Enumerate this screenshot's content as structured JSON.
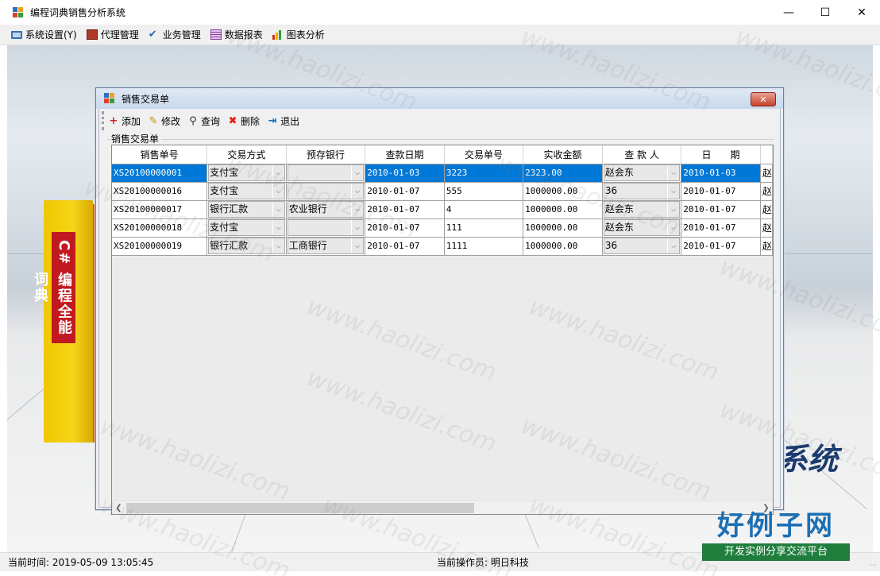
{
  "window": {
    "title": "编程词典销售分析系统"
  },
  "menu": [
    {
      "label": "系统设置(Y)",
      "icon": "monitor-icon"
    },
    {
      "label": "代理管理",
      "icon": "agent-icon"
    },
    {
      "label": "业务管理",
      "icon": "check-icon"
    },
    {
      "label": "数据报表",
      "icon": "report-icon"
    },
    {
      "label": "图表分析",
      "icon": "bar-chart-icon"
    }
  ],
  "child": {
    "title": "销售交易单",
    "toolbar": [
      {
        "label": "添加",
        "icon": "add-icon"
      },
      {
        "label": "修改",
        "icon": "edit-icon"
      },
      {
        "label": "查询",
        "icon": "search-icon"
      },
      {
        "label": "删除",
        "icon": "delete-icon"
      },
      {
        "label": "退出",
        "icon": "exit-icon"
      }
    ],
    "group_label": "销售交易单",
    "columns": [
      "销售单号",
      "交易方式",
      "预存银行",
      "查款日期",
      "交易单号",
      "实收金额",
      "查 款 人",
      "日　　期"
    ],
    "rows": [
      {
        "id": "XS20100000001",
        "method": "支付宝",
        "bank": "",
        "date": "2010-01-03",
        "txn": "3223",
        "amount": "2323.00",
        "checker": "赵会东",
        "day": "2010-01-03",
        "extra": "赵",
        "selected": true
      },
      {
        "id": "XS20100000016",
        "method": "支付宝",
        "bank": "",
        "date": "2010-01-07",
        "txn": "555",
        "amount": "1000000.00",
        "checker": "36",
        "day": "2010-01-07",
        "extra": "赵",
        "selected": false
      },
      {
        "id": "XS20100000017",
        "method": "银行汇款",
        "bank": "农业银行",
        "date": "2010-01-07",
        "txn": "4",
        "amount": "1000000.00",
        "checker": "赵会东",
        "day": "2010-01-07",
        "extra": "赵",
        "selected": false
      },
      {
        "id": "XS20100000018",
        "method": "支付宝",
        "bank": "",
        "date": "2010-01-07",
        "txn": "111",
        "amount": "1000000.00",
        "checker": "赵会东",
        "day": "2010-01-07",
        "extra": "赵",
        "selected": false
      },
      {
        "id": "XS20100000019",
        "method": "银行汇款",
        "bank": "工商银行",
        "date": "2010-01-07",
        "txn": "1111",
        "amount": "1000000.00",
        "checker": "36",
        "day": "2010-01-07",
        "extra": "赵",
        "selected": false
      }
    ]
  },
  "status": {
    "time": "当前时间:  2019-05-09 13:05:45",
    "operator": "当前操作员:  明日科技"
  },
  "background": {
    "logo_text": "系统",
    "book_spine": "C# 编程全能词典"
  },
  "watermark": {
    "text": "www.haolizi.com",
    "brand_title": "好例子网",
    "brand_sub": "开发实例分享交流平台"
  },
  "colors": {
    "selection": "#0078d7",
    "child_title": "#c9d9ec",
    "close_button": "#c8422c"
  }
}
